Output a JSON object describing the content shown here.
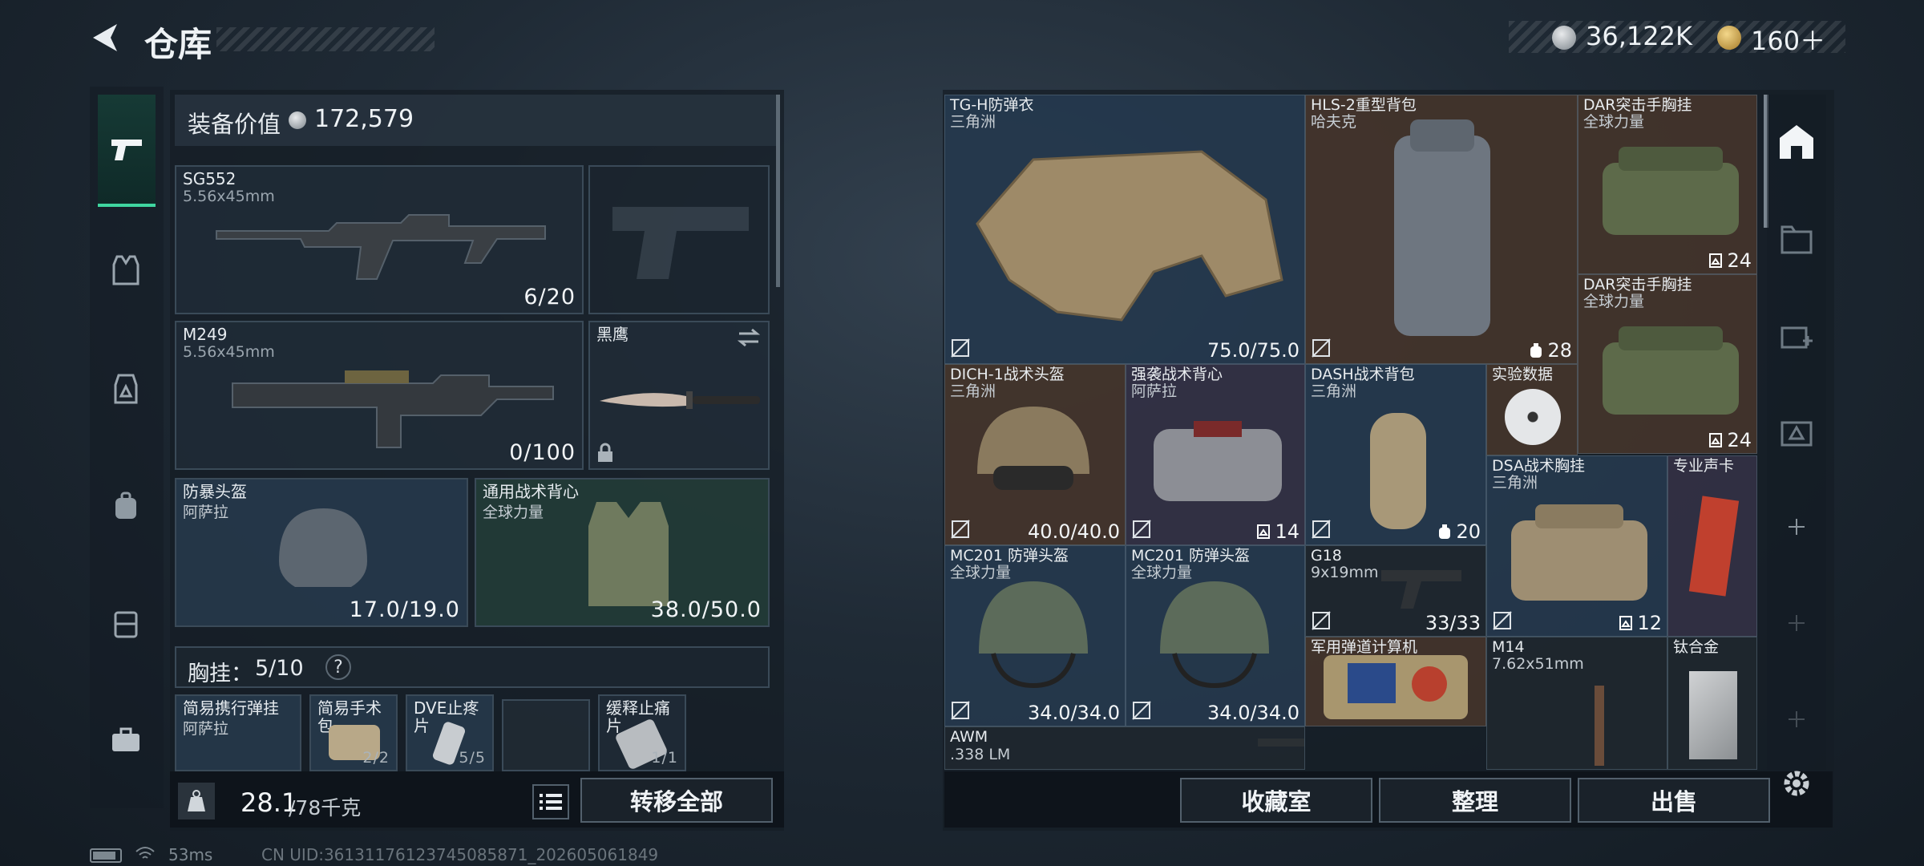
{
  "header": {
    "title": "仓库",
    "currency_value": "36,122K",
    "premium_value": "160＋"
  },
  "equipment": {
    "value_label": "装备价值",
    "value": "172,579",
    "primary": {
      "name": "SG552",
      "caliber": "5.56x45mm",
      "ammo": "6/20"
    },
    "secondary": {
      "name": "M249",
      "caliber": "5.56x45mm",
      "ammo": "0/100"
    },
    "melee": {
      "name": "黑鹰"
    },
    "helmet": {
      "name": "防暴头盔",
      "maker": "阿萨拉",
      "durability": "17.0/19.0"
    },
    "vest": {
      "name": "通用战术背心",
      "maker": "全球力量",
      "durability": "38.0/50.0"
    },
    "chest_rig": {
      "label": "胸挂：",
      "count": "5/10",
      "help": "?"
    },
    "rig_items": [
      {
        "name": "简易携行弹挂",
        "maker": "阿萨拉"
      },
      {
        "name": "简易手术包",
        "count": "2/2"
      },
      {
        "name": "DVE止疼片",
        "count": "5/5"
      },
      {
        "name": ""
      },
      {
        "name": "缓释止痛片",
        "count": "1/1"
      }
    ],
    "weight": "28.1",
    "weight_cap": "/78千克",
    "transfer_all": "转移全部"
  },
  "storage": {
    "items": [
      {
        "name": "TG-H防弹衣",
        "maker": "三角洲",
        "value": "75.0/75.0"
      },
      {
        "name": "HLS-2重型背包",
        "maker": "哈夫克",
        "value": "28"
      },
      {
        "name": "DAR突击手胸挂",
        "maker": "全球力量",
        "value": "24"
      },
      {
        "name": "DAR突击手胸挂",
        "maker": "全球力量",
        "value": "24"
      },
      {
        "name": "DICH-1战术头盔",
        "maker": "三角洲",
        "value": "40.0/40.0"
      },
      {
        "name": "强袭战术背心",
        "maker": "阿萨拉",
        "value": "14"
      },
      {
        "name": "DASH战术背包",
        "maker": "三角洲",
        "value": "20"
      },
      {
        "name": "实验数据"
      },
      {
        "name": "DSA战术胸挂",
        "maker": "三角洲",
        "value": "12"
      },
      {
        "name": "专业声卡"
      },
      {
        "name": "MC201 防弹头盔",
        "maker": "全球力量",
        "value": "34.0/34.0"
      },
      {
        "name": "MC201 防弹头盔",
        "maker": "全球力量",
        "value": "34.0/34.0"
      },
      {
        "name": "G18",
        "maker": "9x19mm",
        "value": "33/33"
      },
      {
        "name": "军用弹道计算机"
      },
      {
        "name": "M14",
        "maker": "7.62x51mm"
      },
      {
        "name": "钛合金"
      },
      {
        "name": "AWM",
        "maker": ".338 LM"
      }
    ],
    "buttons": {
      "collection": "收藏室",
      "sort": "整理",
      "sell": "出售"
    }
  },
  "status": {
    "ping": "53ms",
    "uid": "CN UID:36131176123745085871_202605061849"
  },
  "colors": {
    "accent": "#3fd6a0",
    "background": "#1f2a35"
  }
}
